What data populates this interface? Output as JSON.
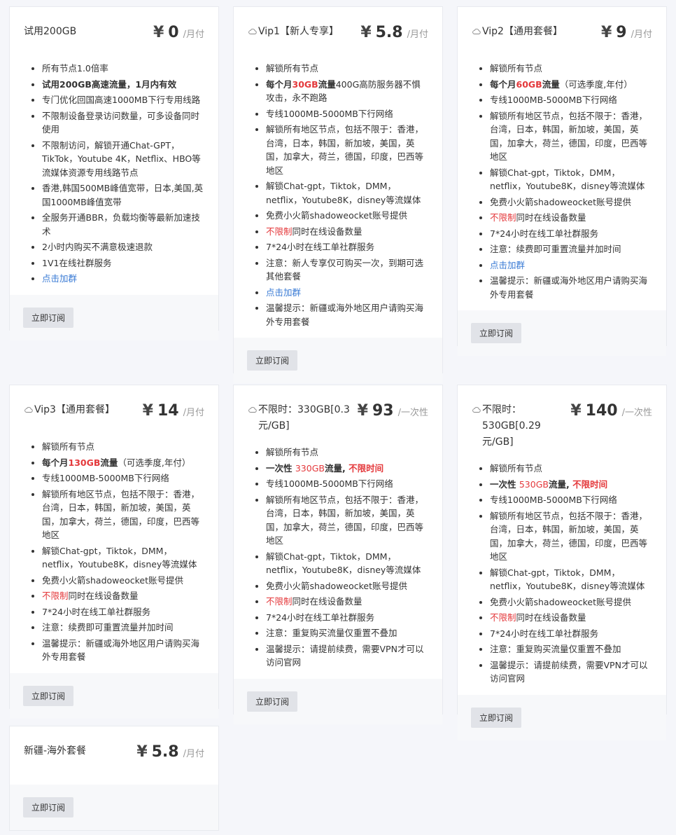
{
  "subscribe_label": "立即订阅",
  "plans": [
    {
      "name": "试用200GB",
      "currency": "¥",
      "price": "0",
      "period": "/月付",
      "features": [
        {
          "text": "所有节点1.0倍率"
        },
        {
          "text": "试用200GB高速流量，1月内有效"
        },
        {
          "text": "专门优化回国高速1000MB下行专用线路"
        },
        {
          "text": "不限制设备登录访问数量，可多设备同时使用"
        },
        {
          "text": "不限制访问，解锁开通Chat-GPT，TikTok，Youtube 4K，Netflix、HBO等流媒体资源专用线路节点"
        },
        {
          "text": "香港,韩国500MB峰值宽带，日本,美国,英国1000MB峰值宽带"
        },
        {
          "text": "全服务开通BBR，负载均衡等最新加速技术"
        },
        {
          "text": "2小时内购买不满意极速退款"
        },
        {
          "text": "1V1在线社群服务"
        },
        {
          "text": "点击加群"
        }
      ]
    },
    {
      "name": "Vip1【新人专享】",
      "currency": "¥",
      "price": "5.8",
      "period": "/月付",
      "features": [
        {
          "text": "解锁所有节点"
        },
        {
          "a": "每个月",
          "b": "30GB",
          "c": "流量",
          "d": "400G高防服务器不惧攻击，永不跑路"
        },
        {
          "text": "专线1000MB-5000MB下行网络"
        },
        {
          "text": "解锁所有地区节点，包括不限于：香港，台湾，日本，韩国，新加坡，美国，英国，加拿大，荷兰，德国，印度，巴西等地区"
        },
        {
          "text": "解锁Chat-gpt，Tiktok，DMM，netflix，Youtube8K，disney等流媒体"
        },
        {
          "text": "免费小火箭shadoweocket账号提供"
        },
        {
          "a": "不限制",
          "b": "同时在线设备数量"
        },
        {
          "text": "7*24小时在线工单社群服务"
        },
        {
          "text": "注意：新人专享仅可购买一次，到期可选其他套餐"
        },
        {
          "text": "点击加群"
        },
        {
          "text": "温馨提示：新疆或海外地区用户请购买海外专用套餐"
        }
      ]
    },
    {
      "name": "Vip2【通用套餐】",
      "currency": "¥",
      "price": "9",
      "period": "/月付",
      "features": [
        {
          "text": "解锁所有节点"
        },
        {
          "a": "每个月",
          "b": "60GB",
          "c": "流量",
          "d": "（可选季度,年付）"
        },
        {
          "text": "专线1000MB-5000MB下行网络"
        },
        {
          "text": "解锁所有地区节点，包括不限于：香港，台湾，日本，韩国，新加坡，美国，英国，加拿大，荷兰，德国，印度，巴西等地区"
        },
        {
          "text": "解锁Chat-gpt，Tiktok，DMM，netflix，Youtube8K，disney等流媒体"
        },
        {
          "text": "免费小火箭shadoweocket账号提供"
        },
        {
          "a": "不限制",
          "b": "同时在线设备数量"
        },
        {
          "text": "7*24小时在线工单社群服务"
        },
        {
          "text": "注意：续费即可重置流量并加时间"
        },
        {
          "text": "点击加群"
        },
        {
          "text": "温馨提示：新疆或海外地区用户请购买海外专用套餐"
        }
      ]
    },
    {
      "name": "Vip3【通用套餐】",
      "currency": "¥",
      "price": "14",
      "period": "/月付",
      "features": [
        {
          "text": "解锁所有节点"
        },
        {
          "a": "每个月",
          "b": "130GB",
          "c": "流量",
          "d": "（可选季度,年付）"
        },
        {
          "text": "专线1000MB-5000MB下行网络"
        },
        {
          "text": "解锁所有地区节点，包括不限于：香港，台湾，日本，韩国，新加坡，美国，英国，加拿大，荷兰，德国，印度，巴西等地区"
        },
        {
          "text": "解锁Chat-gpt，Tiktok，DMM，netflix，Youtube8K，disney等流媒体"
        },
        {
          "text": "免费小火箭shadoweocket账号提供"
        },
        {
          "a": "不限制",
          "b": "同时在线设备数量"
        },
        {
          "text": "7*24小时在线工单社群服务"
        },
        {
          "text": "注意：续费即可重置流量并加时间"
        },
        {
          "text": "温馨提示：新疆或海外地区用户请购买海外专用套餐"
        }
      ]
    },
    {
      "name": "不限时：330GB[0.3元/GB]",
      "currency": "¥",
      "price": "93",
      "period": "/一次性",
      "features": [
        {
          "text": "解锁所有节点"
        },
        {
          "a": "一次性 ",
          "b": "330GB",
          "c": "流量, ",
          "d": "不限时间"
        },
        {
          "text": "专线1000MB-5000MB下行网络"
        },
        {
          "text": "解锁所有地区节点，包括不限于：香港，台湾，日本，韩国，新加坡，美国，英国，加拿大，荷兰，德国，印度，巴西等地区"
        },
        {
          "text": "解锁Chat-gpt，Tiktok，DMM，netflix，Youtube8K，disney等流媒体"
        },
        {
          "text": "免费小火箭shadoweocket账号提供"
        },
        {
          "a": "不限制",
          "b": "同时在线设备数量"
        },
        {
          "text": "7*24小时在线工单社群服务"
        },
        {
          "text": "注意：重复购买流量仅重置不叠加"
        },
        {
          "text": "温馨提示：请提前续费，需要VPN才可以访问官网"
        }
      ]
    },
    {
      "name": "不限时：530GB[0.29元/GB]",
      "currency": "¥",
      "price": "140",
      "period": "/一次性",
      "features": [
        {
          "text": "解锁所有节点"
        },
        {
          "a": "一次性 ",
          "b": "530GB",
          "c": "流量, ",
          "d": "不限时间"
        },
        {
          "text": "专线1000MB-5000MB下行网络"
        },
        {
          "text": "解锁所有地区节点，包括不限于：香港，台湾，日本，韩国，新加坡，美国，英国，加拿大，荷兰，德国，印度，巴西等地区"
        },
        {
          "text": "解锁Chat-gpt，Tiktok，DMM，netflix，Youtube8K，disney等流媒体"
        },
        {
          "text": "免费小火箭shadoweocket账号提供"
        },
        {
          "a": "不限制",
          "b": "同时在线设备数量"
        },
        {
          "text": "7*24小时在线工单社群服务"
        },
        {
          "text": "注意：重复购买流量仅重置不叠加"
        },
        {
          "text": "温馨提示：请提前续费，需要VPN才可以访问官网"
        }
      ]
    },
    {
      "name": "新疆-海外套餐",
      "currency": "¥",
      "price": "5.8",
      "period": "/月付",
      "features": []
    }
  ]
}
